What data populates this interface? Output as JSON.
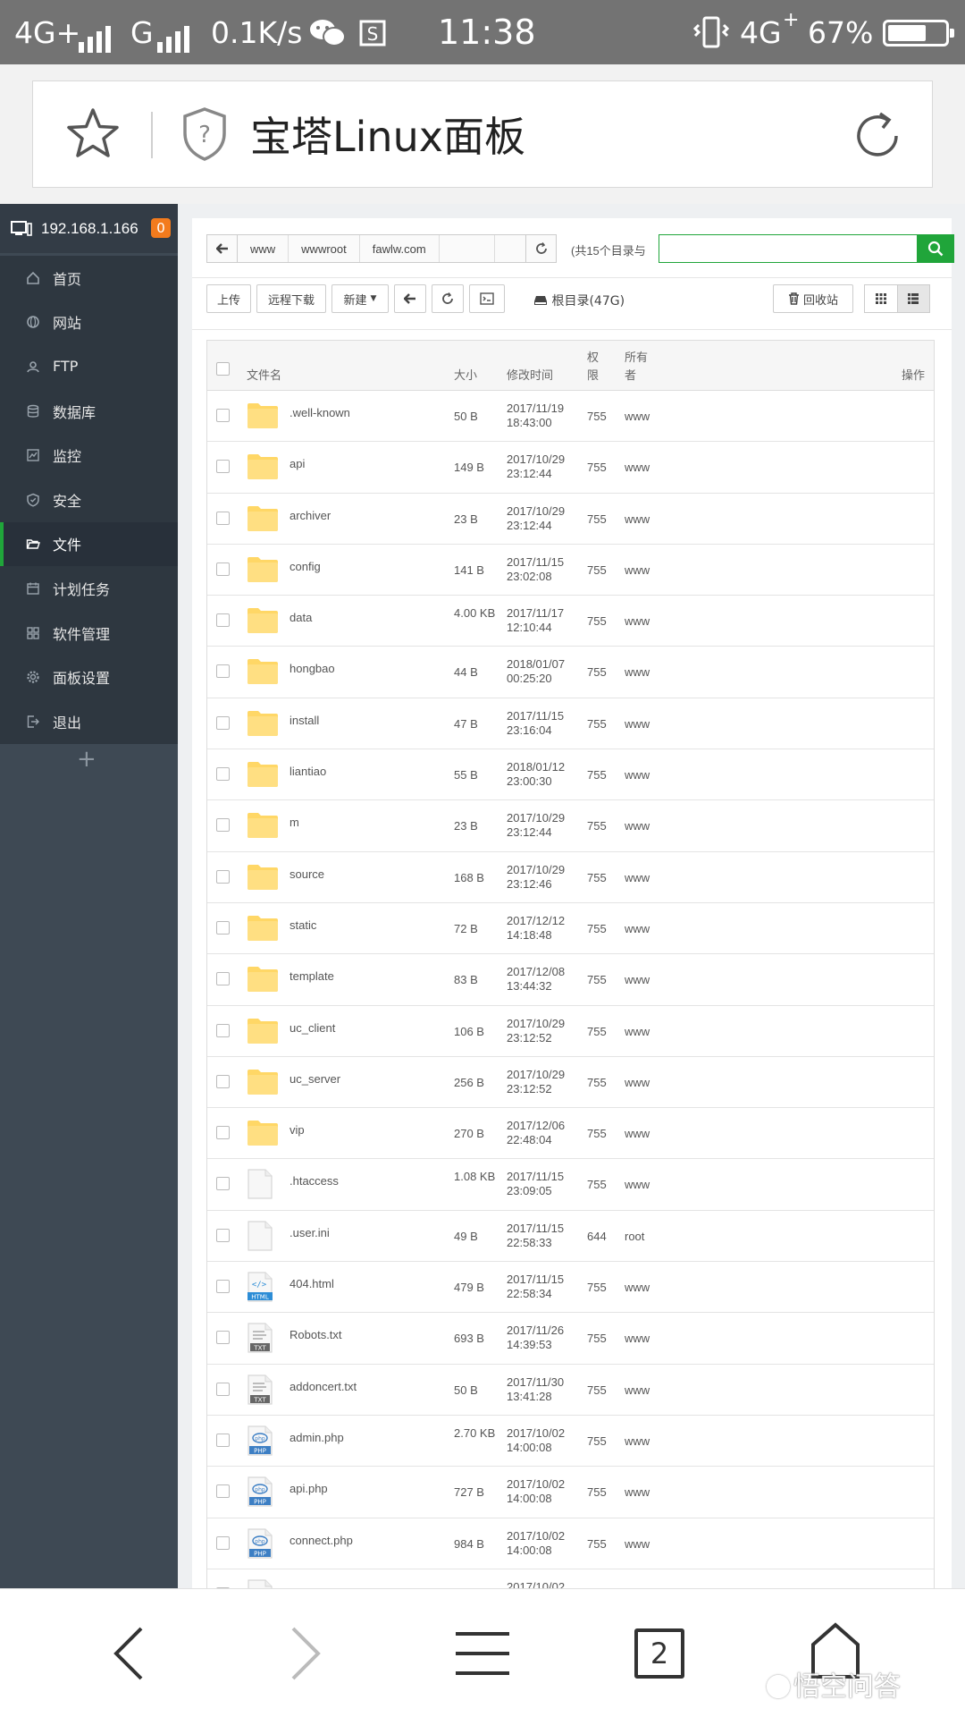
{
  "status_bar": {
    "network_left": "4G+",
    "network_left2": "G",
    "speed": "0.1K/s",
    "time": "11:38",
    "network_right": "4G",
    "battery": "67%",
    "battery_level": 0.67,
    "icons": [
      "signal-icon",
      "wechat-icon",
      "s-app-icon",
      "vibrate-icon",
      "battery-icon"
    ]
  },
  "browser": {
    "page_title": "宝塔Linux面板",
    "icons": [
      "star-icon",
      "shield-question-icon",
      "reload-icon"
    ]
  },
  "sidebar": {
    "server_ip": "192.168.1.166",
    "badge": "0",
    "items": [
      {
        "label": "首页",
        "icon": "home-icon"
      },
      {
        "label": "网站",
        "icon": "globe-icon"
      },
      {
        "label": "FTP",
        "icon": "ftp-icon"
      },
      {
        "label": "数据库",
        "icon": "database-icon"
      },
      {
        "label": "监控",
        "icon": "monitor-icon"
      },
      {
        "label": "安全",
        "icon": "shield-icon"
      },
      {
        "label": "文件",
        "icon": "folder-open-icon"
      },
      {
        "label": "计划任务",
        "icon": "calendar-icon"
      },
      {
        "label": "软件管理",
        "icon": "grid-icon"
      },
      {
        "label": "面板设置",
        "icon": "gear-icon"
      },
      {
        "label": "退出",
        "icon": "logout-icon"
      }
    ],
    "active_item": "文件",
    "add_symbol": "+"
  },
  "path": {
    "segments": [
      "www",
      "wwwroot",
      "fawlw.com"
    ],
    "count_text": "(共15个目录与"
  },
  "toolbar": {
    "upload": "上传",
    "remote_download": "远程下载",
    "new": "新建",
    "root_info": "根目录(47G)",
    "recycle": "回收站"
  },
  "table": {
    "headers": {
      "name": "文件名",
      "size": "大小",
      "mtime": "修改时间",
      "perm_l1": "权",
      "perm_l2": "限",
      "owner_l1": "所有",
      "owner_l2": "者",
      "ops": "操作"
    },
    "rows": [
      {
        "name": ".well-known",
        "type": "folder",
        "size": "50 B",
        "date": "2017/11/19",
        "time": "18:43:00",
        "perm": "755",
        "owner": "www"
      },
      {
        "name": "api",
        "type": "folder",
        "size": "149 B",
        "date": "2017/10/29",
        "time": "23:12:44",
        "perm": "755",
        "owner": "www"
      },
      {
        "name": "archiver",
        "type": "folder",
        "size": "23 B",
        "date": "2017/10/29",
        "time": "23:12:44",
        "perm": "755",
        "owner": "www"
      },
      {
        "name": "config",
        "type": "folder",
        "size": "141 B",
        "date": "2017/11/15",
        "time": "23:02:08",
        "perm": "755",
        "owner": "www"
      },
      {
        "name": "data",
        "type": "folder",
        "size": "4.00 KB",
        "date": "2017/11/17",
        "time": "12:10:44",
        "perm": "755",
        "owner": "www"
      },
      {
        "name": "hongbao",
        "type": "folder",
        "size": "44 B",
        "date": "2018/01/07",
        "time": "00:25:20",
        "perm": "755",
        "owner": "www"
      },
      {
        "name": "install",
        "type": "folder",
        "size": "47 B",
        "date": "2017/11/15",
        "time": "23:16:04",
        "perm": "755",
        "owner": "www"
      },
      {
        "name": "liantiao",
        "type": "folder",
        "size": "55 B",
        "date": "2018/01/12",
        "time": "23:00:30",
        "perm": "755",
        "owner": "www"
      },
      {
        "name": "m",
        "type": "folder",
        "size": "23 B",
        "date": "2017/10/29",
        "time": "23:12:44",
        "perm": "755",
        "owner": "www"
      },
      {
        "name": "source",
        "type": "folder",
        "size": "168 B",
        "date": "2017/10/29",
        "time": "23:12:46",
        "perm": "755",
        "owner": "www"
      },
      {
        "name": "static",
        "type": "folder",
        "size": "72 B",
        "date": "2017/12/12",
        "time": "14:18:48",
        "perm": "755",
        "owner": "www"
      },
      {
        "name": "template",
        "type": "folder",
        "size": "83 B",
        "date": "2017/12/08",
        "time": "13:44:32",
        "perm": "755",
        "owner": "www"
      },
      {
        "name": "uc_client",
        "type": "folder",
        "size": "106 B",
        "date": "2017/10/29",
        "time": "23:12:52",
        "perm": "755",
        "owner": "www"
      },
      {
        "name": "uc_server",
        "type": "folder",
        "size": "256 B",
        "date": "2017/10/29",
        "time": "23:12:52",
        "perm": "755",
        "owner": "www"
      },
      {
        "name": "vip",
        "type": "folder",
        "size": "270 B",
        "date": "2017/12/06",
        "time": "22:48:04",
        "perm": "755",
        "owner": "www"
      },
      {
        "name": ".htaccess",
        "type": "file",
        "size": "1.08 KB",
        "date": "2017/11/15",
        "time": "23:09:05",
        "perm": "755",
        "owner": "www"
      },
      {
        "name": ".user.ini",
        "type": "file",
        "size": "49 B",
        "date": "2017/11/15",
        "time": "22:58:33",
        "perm": "644",
        "owner": "root"
      },
      {
        "name": "404.html",
        "type": "html",
        "size": "479 B",
        "date": "2017/11/15",
        "time": "22:58:34",
        "perm": "755",
        "owner": "www"
      },
      {
        "name": "Robots.txt",
        "type": "txt",
        "size": "693 B",
        "date": "2017/11/26",
        "time": "14:39:53",
        "perm": "755",
        "owner": "www"
      },
      {
        "name": "addoncert.txt",
        "type": "txt",
        "size": "50 B",
        "date": "2017/11/30",
        "time": "13:41:28",
        "perm": "755",
        "owner": "www"
      },
      {
        "name": "admin.php",
        "type": "php",
        "size": "2.70 KB",
        "date": "2017/10/02",
        "time": "14:00:08",
        "perm": "755",
        "owner": "www"
      },
      {
        "name": "api.php",
        "type": "php",
        "size": "727 B",
        "date": "2017/10/02",
        "time": "14:00:08",
        "perm": "755",
        "owner": "www"
      },
      {
        "name": "connect.php",
        "type": "php",
        "size": "984 B",
        "date": "2017/10/02",
        "time": "14:00:08",
        "perm": "755",
        "owner": "www"
      },
      {
        "name": "",
        "type": "file",
        "size": "",
        "date": "2017/10/02",
        "time": "",
        "perm": "",
        "owner": ""
      }
    ],
    "icon_labels": {
      "html": "HTML",
      "txt": "TXT",
      "php": "PHP"
    }
  },
  "bottom_nav": {
    "tab_count": "2",
    "watermark": "悟空问答",
    "icons": [
      "back-icon",
      "forward-icon",
      "menu-icon",
      "tabs-icon",
      "home-icon"
    ]
  },
  "colors": {
    "accent_green": "#20a53a",
    "badge_orange": "#f37b1d",
    "folder_yellow": "#ffd766",
    "sidebar_bg": "#3e4954",
    "status_bar": "#737373"
  }
}
